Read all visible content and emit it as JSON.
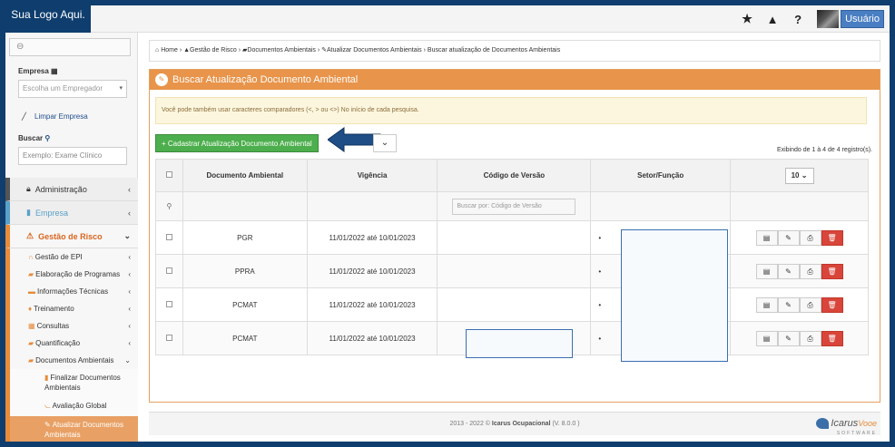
{
  "header": {
    "logo": "Sua Logo Aqui.",
    "user_label": "Usuário"
  },
  "sidebar": {
    "empresa_label": "Empresa",
    "empresa_placeholder": "Escolha um Empregador",
    "limpar_label": "Limpar Empresa",
    "buscar_label": "Buscar",
    "buscar_placeholder": "Exemplo: Exame Clínico",
    "menu": {
      "administracao": "Administração",
      "empresa": "Empresa",
      "gestao_risco": "Gestão de Risco"
    },
    "submenu": {
      "gestao_epi": "Gestão de EPI",
      "elaboracao": "Elaboração de Programas",
      "informacoes": "Informações Técnicas",
      "treinamento": "Treinamento",
      "consultas": "Consultas",
      "quantificacao": "Quantificação",
      "documentos": "Documentos Ambientais"
    },
    "sub2": {
      "finalizar": "Finalizar Documentos Ambientais",
      "avaliacao": "Avaliação Global",
      "atualizar": "Atualizar Documentos Ambientais"
    }
  },
  "breadcrumb": {
    "home": "Home",
    "gestao": "Gestão de Risco",
    "documentos": "Documentos Ambientais",
    "atualizar": "Atualizar Documentos Ambientais",
    "current": "Buscar atualização de Documentos Ambientais"
  },
  "panel": {
    "title": "Buscar Atualização Documento Ambiental",
    "alert": "Você pode também usar caracteres comparadores (<, > ou <>) No início de cada pesquisa.",
    "add_button": "+ Cadastrar Atualização Documento Ambiental",
    "count": "Exibindo de 1 à 4 de 4 registro(s)."
  },
  "table": {
    "headers": [
      "Documento Ambiental",
      "Vigência",
      "Código de Versão",
      "Setor/Função"
    ],
    "page_size": "10",
    "filter_placeholder": "Buscar por: Código de Versão",
    "rows": [
      {
        "doc": "PGR",
        "vigencia": "11/01/2022 até 10/01/2023"
      },
      {
        "doc": "PPRA",
        "vigencia": "11/01/2022 até 10/01/2023"
      },
      {
        "doc": "PCMAT",
        "vigencia": "11/01/2022 até 10/01/2023"
      },
      {
        "doc": "PCMAT",
        "vigencia": "11/01/2022 até 10/01/2023"
      }
    ]
  },
  "footer": {
    "years": "2013 - 2022 ©",
    "company": "Icarus Ocupacional",
    "version": "(V. 8.0.0 )",
    "brand": "Icarus",
    "brand_suffix": "Vooe",
    "brand_sub": "SOFTWARE"
  },
  "colors": {
    "accent": "#e8944a",
    "navy": "#0e3d6e",
    "success": "#4cae4c",
    "danger": "#d9453a"
  }
}
